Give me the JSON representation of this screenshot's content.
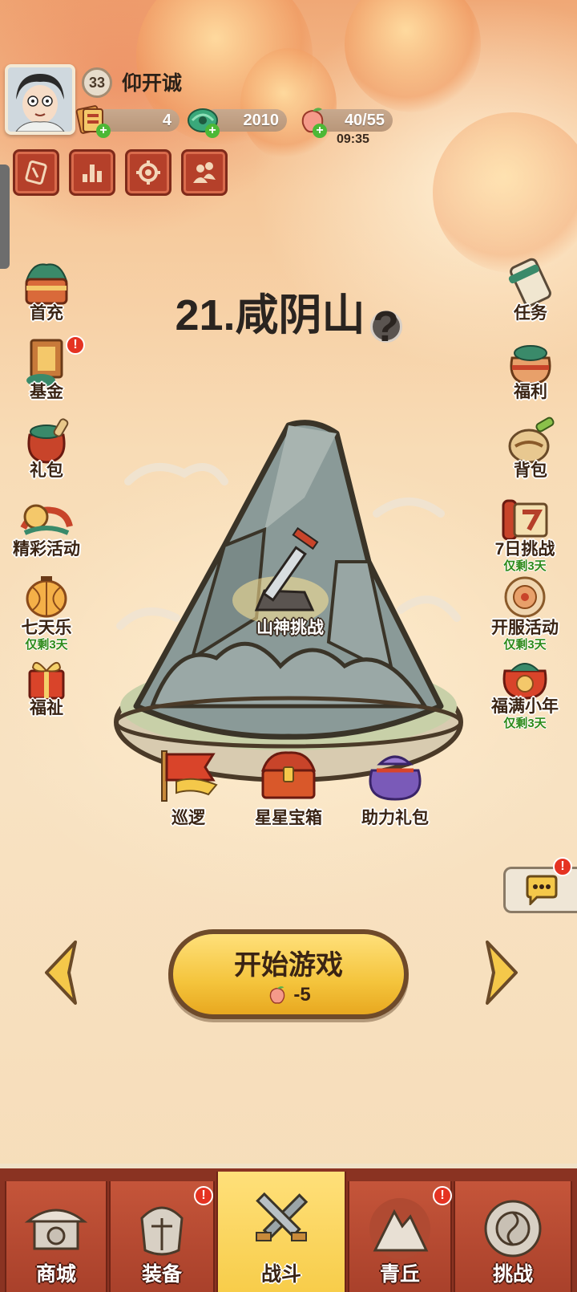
{
  "player": {
    "level": "33",
    "name": "仰开诚"
  },
  "resources": {
    "tickets": "4",
    "jade": "2010",
    "stamina": "40/55",
    "stamina_timer": "09:35"
  },
  "top_buttons": [
    "ticket-icon",
    "ranking-icon",
    "settings-icon",
    "friends-icon"
  ],
  "stage": {
    "title": "21.咸阴山",
    "help_symbol": "?",
    "boss_label": "山神挑战"
  },
  "stage_items": {
    "patrol": "巡逻",
    "star_chest": "星星宝箱",
    "help_pack": "助力礼包"
  },
  "left_menu": [
    {
      "label": "首充"
    },
    {
      "label": "基金",
      "alert": "!"
    },
    {
      "label": "礼包"
    },
    {
      "label": "精彩活动"
    },
    {
      "label": "七天乐",
      "sub": "仅剩3天"
    },
    {
      "label": "福祉"
    }
  ],
  "right_menu": [
    {
      "label": "任务"
    },
    {
      "label": "福利"
    },
    {
      "label": "背包"
    },
    {
      "label": "7日挑战",
      "sub": "仅剩3天"
    },
    {
      "label": "开服活动",
      "sub": "仅剩3天"
    },
    {
      "label": "福满小年",
      "sub": "仅剩3天"
    }
  ],
  "chat": {
    "alert": "!"
  },
  "start": {
    "label": "开始游戏",
    "cost": "-5"
  },
  "nav": {
    "tabs": [
      {
        "label": "商城"
      },
      {
        "label": "装备",
        "alert": "!"
      },
      {
        "label": "战斗"
      },
      {
        "label": "青丘",
        "alert": "!"
      },
      {
        "label": "挑战"
      }
    ],
    "active_index": 2
  },
  "colors": {
    "accent_red": "#b5402a",
    "button_yellow": "#f4c43c",
    "nav_red": "#a8402a",
    "alert_red": "#e53322",
    "sub_green": "#2e8a1a"
  }
}
